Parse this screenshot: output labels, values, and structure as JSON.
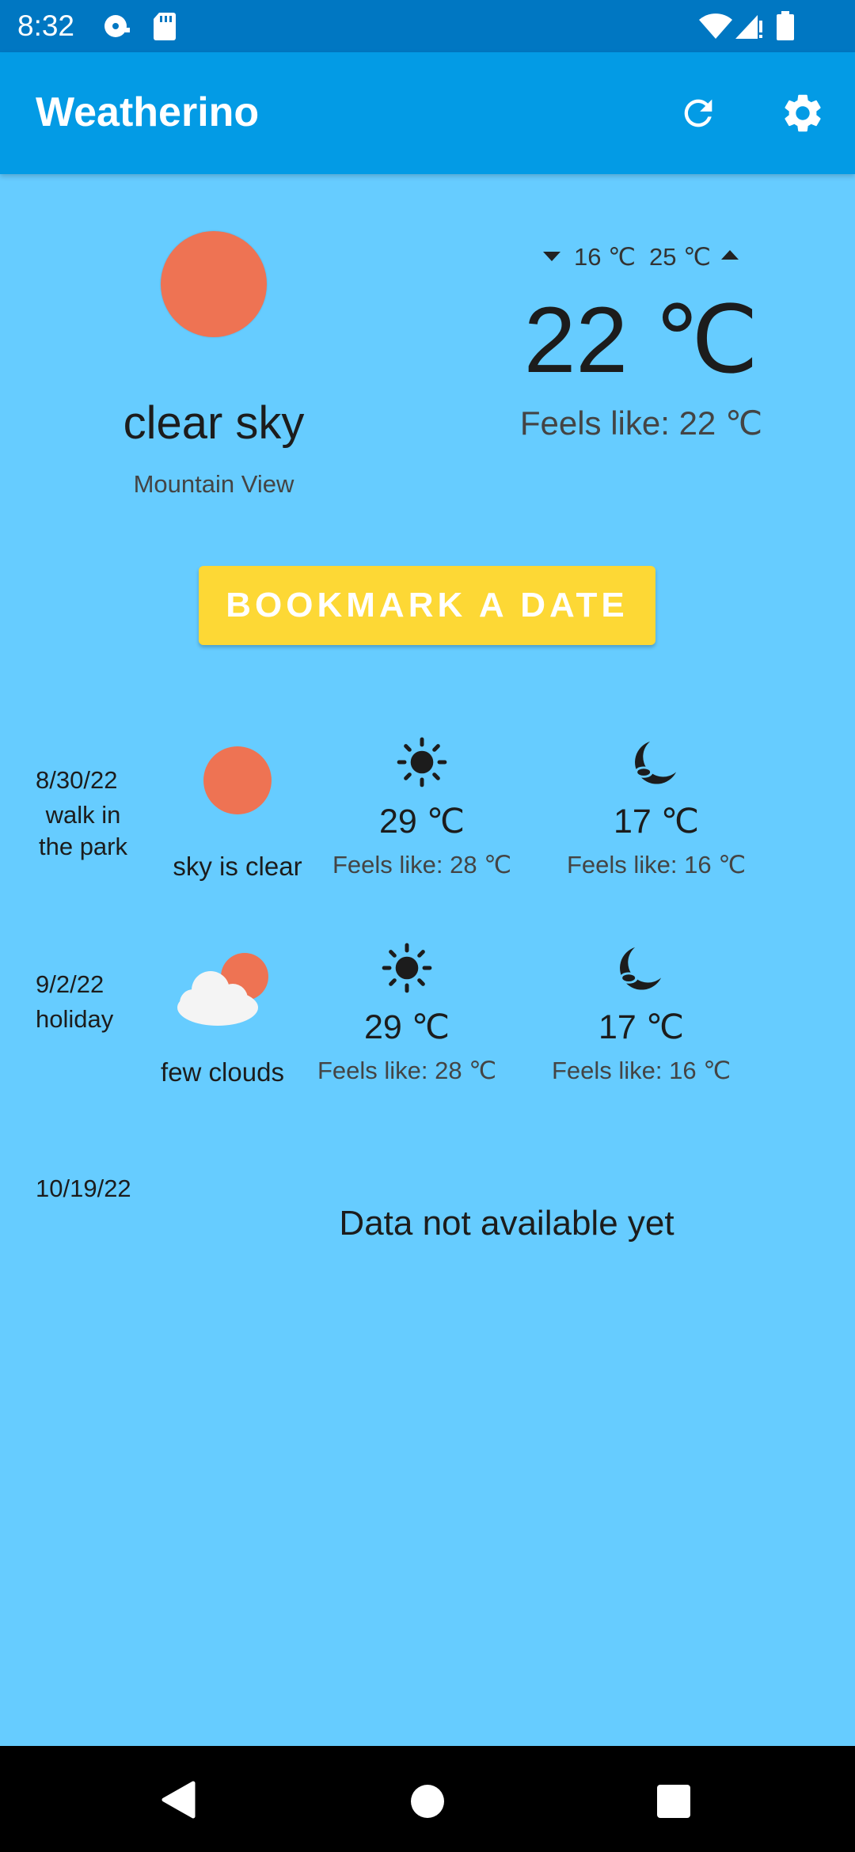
{
  "status_bar": {
    "time": "8:32",
    "icons": [
      "media-icon",
      "sd-card-icon",
      "wifi-icon",
      "signal-icon",
      "battery-icon"
    ]
  },
  "app_bar": {
    "title": "Weatherino",
    "actions": [
      "refresh-icon",
      "settings-icon"
    ]
  },
  "current": {
    "icon": "clear-sky-sun-icon",
    "description": "clear sky",
    "location": "Mountain View",
    "min_temp": "16 ℃",
    "max_temp": "25 ℃",
    "temperature": "22 ℃",
    "feels_like": "Feels like: 22 ℃"
  },
  "bookmark_button": {
    "label": "BOOKMARK A DATE"
  },
  "bookmarks": [
    {
      "date": "8/30/22",
      "label": "walk in\nthe park",
      "condition": "sky is clear",
      "condition_icon": "clear-sky-sun-icon",
      "day": {
        "icon": "sun-icon",
        "temp": "29 ℃",
        "feels": "Feels like: 28 ℃"
      },
      "night": {
        "icon": "moon-icon",
        "temp": "17 ℃",
        "feels": "Feels like: 16 ℃"
      }
    },
    {
      "date": "9/2/22",
      "label": "holiday",
      "condition": "few clouds",
      "condition_icon": "few-clouds-icon",
      "day": {
        "icon": "sun-icon",
        "temp": "29 ℃",
        "feels": "Feels like: 28 ℃"
      },
      "night": {
        "icon": "moon-icon",
        "temp": "17 ℃",
        "feels": "Feels like: 16 ℃"
      }
    },
    {
      "date": "10/19/22",
      "message": "Data not available yet"
    }
  ],
  "nav_bar": {
    "buttons": [
      "back-icon",
      "home-icon",
      "recents-icon"
    ]
  },
  "colors": {
    "status_bar": "#0077c2",
    "app_bar": "#039be5",
    "background": "#66ccff",
    "accent_button": "#fdd835",
    "sun": "#ee7353"
  }
}
